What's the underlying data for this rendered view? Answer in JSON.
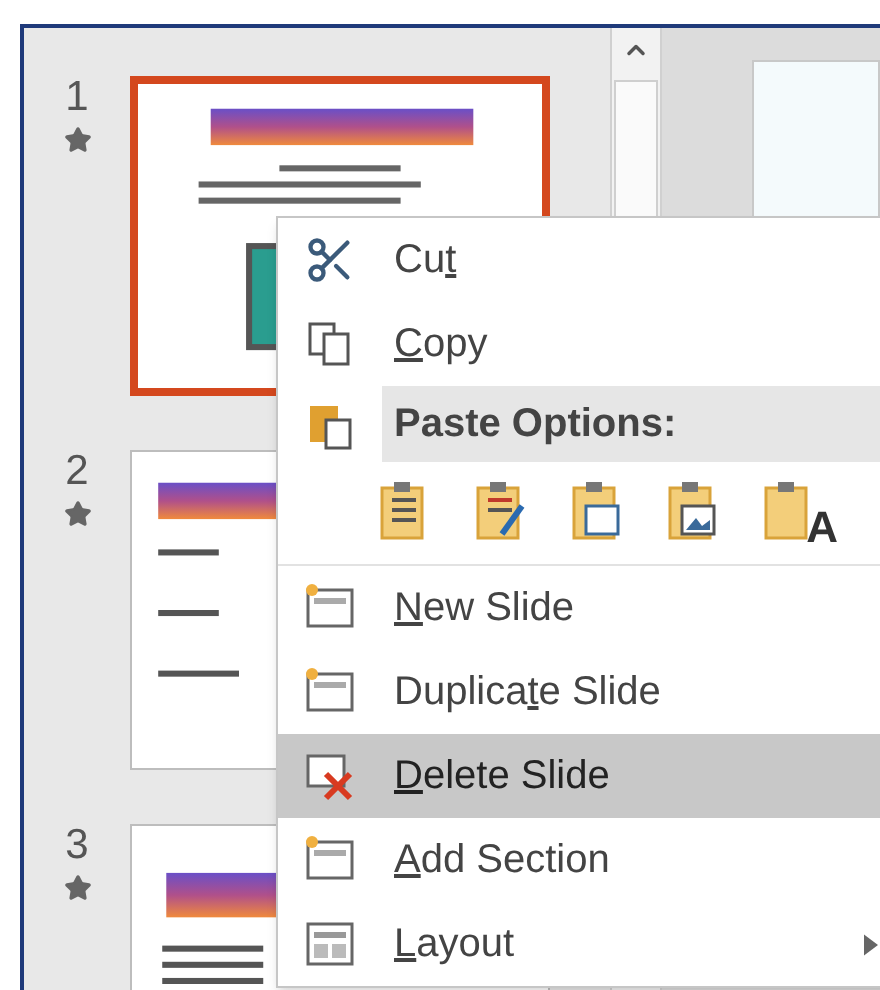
{
  "slides": [
    {
      "number": "1",
      "starred": true,
      "selected": true,
      "kind": "title"
    },
    {
      "number": "2",
      "starred": true,
      "selected": false,
      "kind": "bullets"
    },
    {
      "number": "3",
      "starred": true,
      "selected": false,
      "kind": "text"
    }
  ],
  "context_menu": {
    "items": [
      {
        "kind": "command",
        "pre": "Cu",
        "key": "t",
        "highlighted": false,
        "submenu": false
      },
      {
        "kind": "command",
        "key": "C",
        "post": "opy",
        "highlighted": false,
        "submenu": false
      },
      {
        "kind": "header",
        "pre": "Paste Options:"
      },
      {
        "kind": "paste-row",
        "options": [
          {
            "kind": "destination"
          },
          {
            "kind": "source"
          },
          {
            "kind": "embed"
          },
          {
            "kind": "picture"
          },
          {
            "kind": "text",
            "glyph": "A"
          }
        ]
      },
      {
        "kind": "command",
        "key": "N",
        "post": "ew Slide",
        "highlighted": false,
        "submenu": false
      },
      {
        "kind": "command",
        "pre": "Duplica",
        "key": "t",
        "post": "e Slide",
        "highlighted": false,
        "submenu": false
      },
      {
        "kind": "command",
        "key": "D",
        "post": "elete Slide",
        "highlighted": true,
        "submenu": false
      },
      {
        "kind": "command",
        "key": "A",
        "post": "dd Section",
        "highlighted": false,
        "submenu": false
      },
      {
        "kind": "command",
        "key": "L",
        "post": "ayout",
        "highlighted": false,
        "submenu": true
      }
    ]
  }
}
